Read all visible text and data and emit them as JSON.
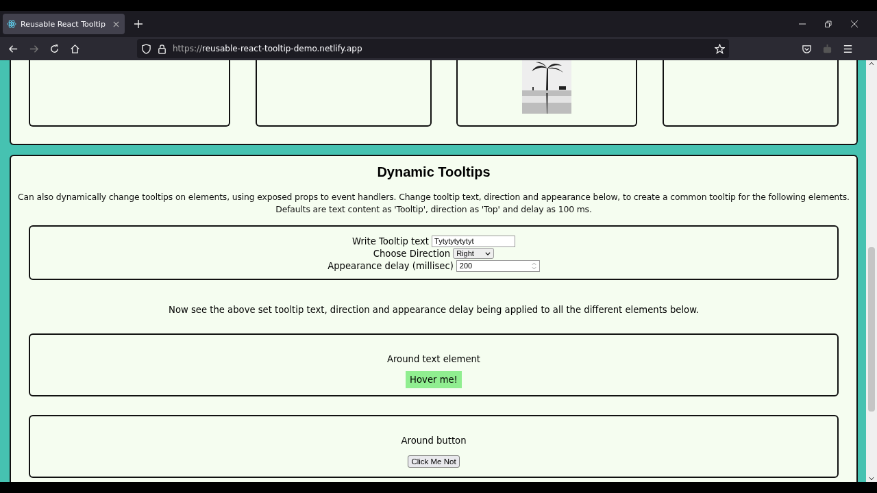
{
  "browser": {
    "tab_title": "Reusable React Tooltip",
    "url_prefix": "https://",
    "url_host": "reusable-react-tooltip-demo.netlify.app"
  },
  "top_cards": [
    {
      "kind": "empty"
    },
    {
      "kind": "empty"
    },
    {
      "kind": "picture"
    },
    {
      "kind": "empty"
    }
  ],
  "dynamic": {
    "title": "Dynamic Tooltips",
    "description": "Can also dynamically change tooltips on elements, using exposed props to event handlers. Change tooltip text, direction and appearance below, to create a common tooltip for the following elements. Defaults are text content as 'Tooltip', direction as 'Top' and delay as 100 ms.",
    "controls": [
      {
        "kind": "text",
        "label": "Write Tooltip text",
        "value": "Tytytytytytyt"
      },
      {
        "kind": "select",
        "label": "Choose Direction",
        "value": "Right"
      },
      {
        "kind": "number",
        "label": "Appearance delay (millisec)",
        "value": "200"
      }
    ],
    "note": "Now see the above set tooltip text, direction and appearance delay being applied to all the different elements below.",
    "demos": [
      {
        "kind": "text",
        "caption": "Around text element",
        "target": "Hover me!"
      },
      {
        "kind": "button",
        "caption": "Around button",
        "target": "Click Me Not"
      }
    ]
  }
}
